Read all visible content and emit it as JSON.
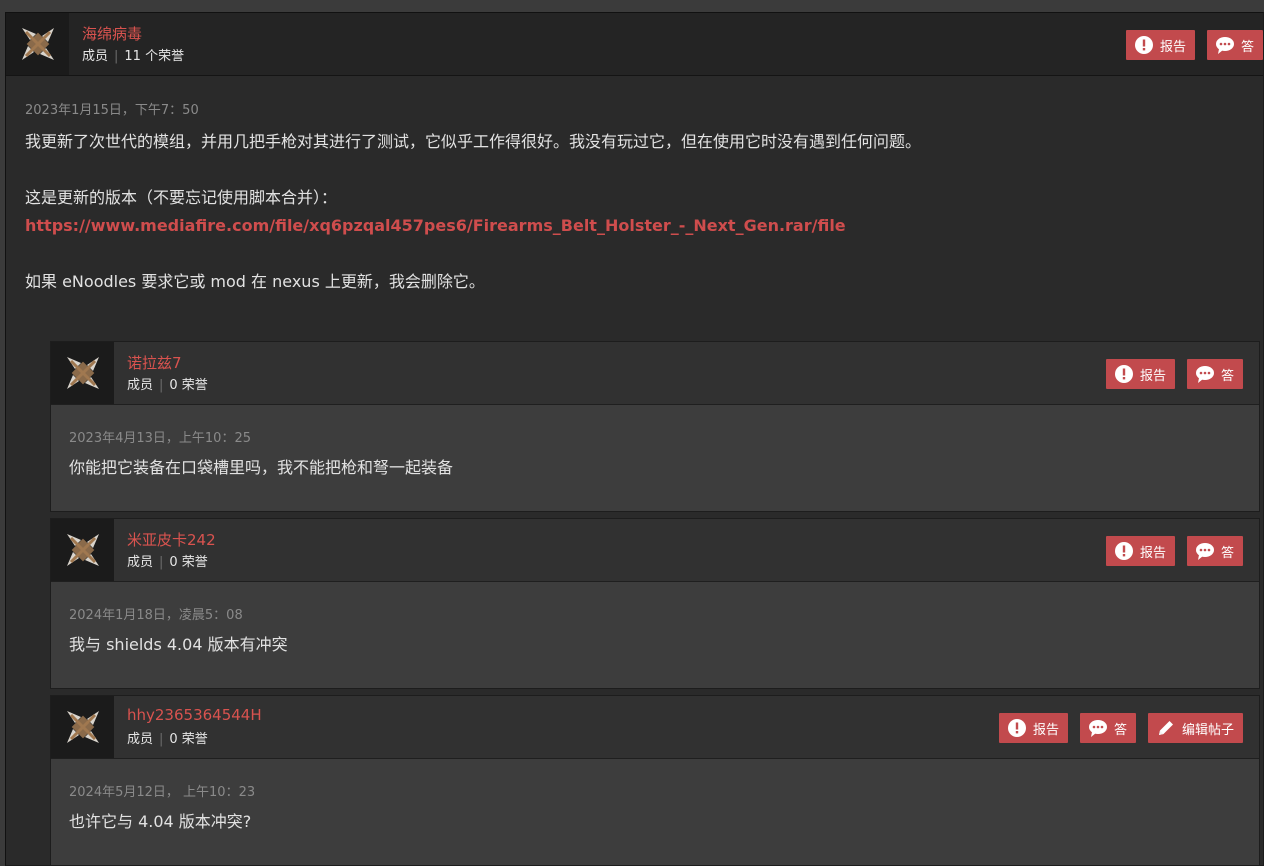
{
  "main_post": {
    "username": "海绵病毒",
    "role": "成员",
    "kudos": "11 个荣誉",
    "report_label": "报告",
    "reply_label": "答",
    "date": "2023年1月15日，下午7：50",
    "line1": "我更新了次世代的模组，并用几把手枪对其进行了测试，它似乎工作得很好。我没有玩过它，但在使用它时没有遇到任何问题。",
    "line2": "这是更新的版本（不要忘记使用脚本合并）：",
    "link": "https://www.mediafire.com/file/xq6pzqal457pes6/Firearms_Belt_Holster_-_Next_Gen.rar/file",
    "line3": "如果 eNoodles 要求它或 mod 在 nexus 上更新，我会删除它。"
  },
  "replies": [
    {
      "username": "诺拉兹7",
      "role": "成员",
      "kudos": "0 荣誉",
      "report_label": "报告",
      "reply_label": "答",
      "date": "2023年4月13日，上午10：25",
      "text": "你能把它装备在口袋槽里吗，我不能把枪和弩一起装备"
    },
    {
      "username": "米亚皮卡242",
      "role": "成员",
      "kudos": "0 荣誉",
      "report_label": "报告",
      "reply_label": "答",
      "date": "2024年1月18日，凌晨5：08",
      "text": "我与 shields 4.04 版本有冲突"
    },
    {
      "username": "hhy2365364544H",
      "role": "成员",
      "kudos": "0 荣誉",
      "report_label": "报告",
      "reply_label": "答",
      "edit_label": "编辑帖子",
      "date": "2024年5月12日， 上午10：23",
      "text": "也许它与 4.04 版本冲突?"
    }
  ],
  "colors": {
    "accent": "#c24a4d",
    "username": "#d9534f",
    "background": "#2a2a2a"
  },
  "icons": {
    "avatar": "nexus-logo-icon",
    "report": "exclamation-circle-icon",
    "reply": "speech-bubble-icon",
    "edit": "pencil-icon"
  }
}
